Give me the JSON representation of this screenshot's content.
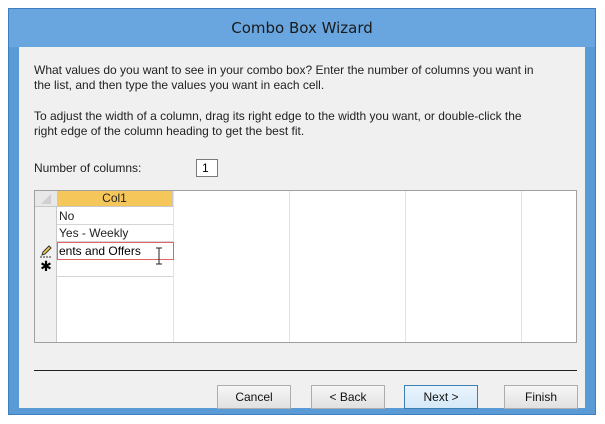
{
  "window": {
    "title": "Combo Box Wizard"
  },
  "intro": {
    "line1": "What values do you want to see in your combo box? Enter the number of columns you want in",
    "line2": "the list, and then type the values you want in each cell.",
    "line3": "To adjust the width of a column, drag its right edge to the width you want, or double-click the",
    "line4": "right edge of the column heading to get the best fit."
  },
  "columns": {
    "label": "Number of columns:",
    "value": "1"
  },
  "grid": {
    "header": "Col1",
    "rows": [
      "No",
      "Yes - Weekly"
    ],
    "editing_value": "ents and Offers",
    "edit_icon": "pencil-icon",
    "new_row_icon": "asterisk-icon"
  },
  "buttons": {
    "cancel": "Cancel",
    "back": "< Back",
    "next": "Next >",
    "finish": "Finish"
  }
}
